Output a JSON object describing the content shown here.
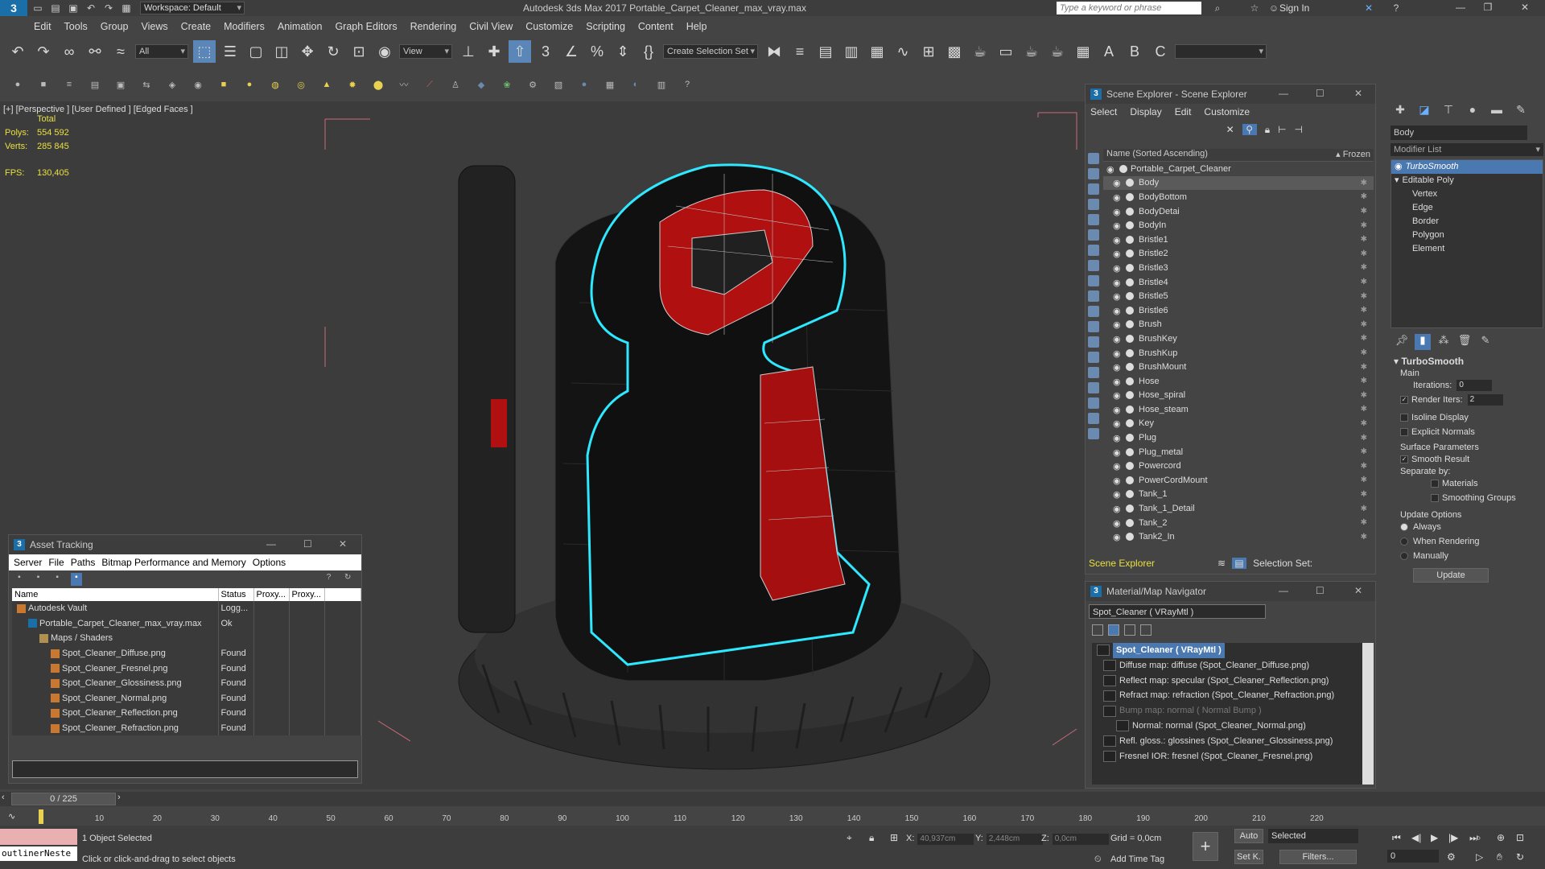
{
  "app": {
    "logo": "3",
    "title": "Autodesk 3ds Max 2017     Portable_Carpet_Cleaner_max_vray.max",
    "workspace": "Workspace: Default",
    "search_placeholder": "Type a keyword or phrase",
    "sign_in": "Sign In",
    "minimize": "—",
    "restore": "❐",
    "close": "✕"
  },
  "menu": [
    "Edit",
    "Tools",
    "Group",
    "Views",
    "Create",
    "Modifiers",
    "Animation",
    "Graph Editors",
    "Rendering",
    "Civil View",
    "Customize",
    "Scripting",
    "Content",
    "Help"
  ],
  "toolbar": {
    "filter": "All",
    "ref_coord": "View",
    "selection_set": "Create Selection Set"
  },
  "viewport": {
    "label": "[+] [Perspective ] [User Defined ] [Edged Faces ]",
    "stats_header": "Total",
    "polys_label": "Polys:",
    "polys_value": "554 592",
    "verts_label": "Verts:",
    "verts_value": "285 845",
    "fps_label": "FPS:",
    "fps_value": "130,405"
  },
  "scene_explorer": {
    "title": "Scene Explorer - Scene Explorer",
    "menu": [
      "Select",
      "Display",
      "Edit",
      "Customize"
    ],
    "col_name": "Name (Sorted Ascending)",
    "col_frozen": "▴ Frozen",
    "root": "Portable_Carpet_Cleaner",
    "items": [
      "Body",
      "BodyBottom",
      "BodyDetai",
      "BodyIn",
      "Bristle1",
      "Bristle2",
      "Bristle3",
      "Bristle4",
      "Bristle5",
      "Bristle6",
      "Brush",
      "BrushKey",
      "BrushKup",
      "BrushMount",
      "Hose",
      "Hose_spiral",
      "Hose_steam",
      "Key",
      "Plug",
      "Plug_metal",
      "Powercord",
      "PowerCordMount",
      "Tank_1",
      "Tank_1_Detail",
      "Tank_2",
      "Tank2_In"
    ],
    "footer_explorer": "Scene Explorer",
    "footer_selset": "Selection Set:"
  },
  "command_panel": {
    "object_name": "Body",
    "modifier_list": "Modifier List",
    "stack": [
      "TurboSmooth",
      "Editable Poly",
      "Vertex",
      "Edge",
      "Border",
      "Polygon",
      "Element"
    ],
    "rollout_title": "TurboSmooth",
    "main": "Main",
    "iterations_label": "Iterations:",
    "iterations_value": "0",
    "render_iters_label": "Render Iters:",
    "render_iters_value": "2",
    "isoline": "Isoline Display",
    "explicit_normals": "Explicit Normals",
    "surface_params": "Surface Parameters",
    "smooth_result": "Smooth Result",
    "separate_by": "Separate by:",
    "materials": "Materials",
    "smoothing_groups": "Smoothing Groups",
    "update_options": "Update Options",
    "always": "Always",
    "when_rendering": "When Rendering",
    "manually": "Manually",
    "update_button": "Update"
  },
  "asset_tracking": {
    "title": "Asset Tracking",
    "menu": [
      "Server",
      "File",
      "Paths",
      "Bitmap Performance and Memory",
      "Options"
    ],
    "columns": [
      "Name",
      "Status",
      "Proxy...",
      "Proxy..."
    ],
    "rows": [
      {
        "name": "Autodesk Vault",
        "status": "Logg...",
        "indent": 0,
        "icon": "vault"
      },
      {
        "name": "Portable_Carpet_Cleaner_max_vray.max",
        "status": "Ok",
        "indent": 1,
        "icon": "max"
      },
      {
        "name": "Maps / Shaders",
        "status": "",
        "indent": 2,
        "icon": "folder"
      },
      {
        "name": "Spot_Cleaner_Diffuse.png",
        "status": "Found",
        "indent": 3,
        "icon": "png"
      },
      {
        "name": "Spot_Cleaner_Fresnel.png",
        "status": "Found",
        "indent": 3,
        "icon": "png"
      },
      {
        "name": "Spot_Cleaner_Glossiness.png",
        "status": "Found",
        "indent": 3,
        "icon": "png"
      },
      {
        "name": "Spot_Cleaner_Normal.png",
        "status": "Found",
        "indent": 3,
        "icon": "png"
      },
      {
        "name": "Spot_Cleaner_Reflection.png",
        "status": "Found",
        "indent": 3,
        "icon": "png"
      },
      {
        "name": "Spot_Cleaner_Refraction.png",
        "status": "Found",
        "indent": 3,
        "icon": "png"
      }
    ]
  },
  "material_navigator": {
    "title": "Material/Map Navigator",
    "material_field": "Spot_Cleaner  ( VRayMtl )",
    "rows": [
      {
        "text": "Spot_Cleaner  ( VRayMtl )",
        "type": "head"
      },
      {
        "text": "Diffuse map: diffuse (Spot_Cleaner_Diffuse.png)",
        "type": "map"
      },
      {
        "text": "Reflect map: specular (Spot_Cleaner_Reflection.png)",
        "type": "map"
      },
      {
        "text": "Refract map: refraction (Spot_Cleaner_Refraction.png)",
        "type": "map"
      },
      {
        "text": "Bump map: normal  ( Normal Bump )",
        "type": "dim"
      },
      {
        "text": "Normal: normal (Spot_Cleaner_Normal.png)",
        "type": "sub"
      },
      {
        "text": "Refl. gloss.: glossines (Spot_Cleaner_Glossiness.png)",
        "type": "map"
      },
      {
        "text": "Fresnel IOR: fresnel (Spot_Cleaner_Fresnel.png)",
        "type": "map"
      }
    ]
  },
  "timeline": {
    "slider": "0 / 225",
    "ticks": [
      "10",
      "20",
      "30",
      "40",
      "50",
      "60",
      "70",
      "80",
      "90",
      "100",
      "110",
      "120",
      "130",
      "140",
      "150",
      "160",
      "170",
      "180",
      "190",
      "200",
      "210",
      "220"
    ]
  },
  "status": {
    "maxscript": "outlinerNeste",
    "selected": "1 Object Selected",
    "prompt": "Click or click-and-drag to select objects",
    "x_label": "X:",
    "x_value": "40,937cm",
    "y_label": "Y:",
    "y_value": "2,448cm",
    "z_label": "Z:",
    "z_value": "0,0cm",
    "grid": "Grid = 0,0cm",
    "add_time_tag": "Add Time Tag",
    "auto_key": "Auto",
    "set_key": "Set K.",
    "key_filter": "Selected",
    "filters": "Filters...",
    "frame": "0"
  },
  "colors": {
    "selection_outline": "#2ee8ff",
    "accent_red": "#b01010",
    "highlight_blue": "#4a78b0"
  }
}
